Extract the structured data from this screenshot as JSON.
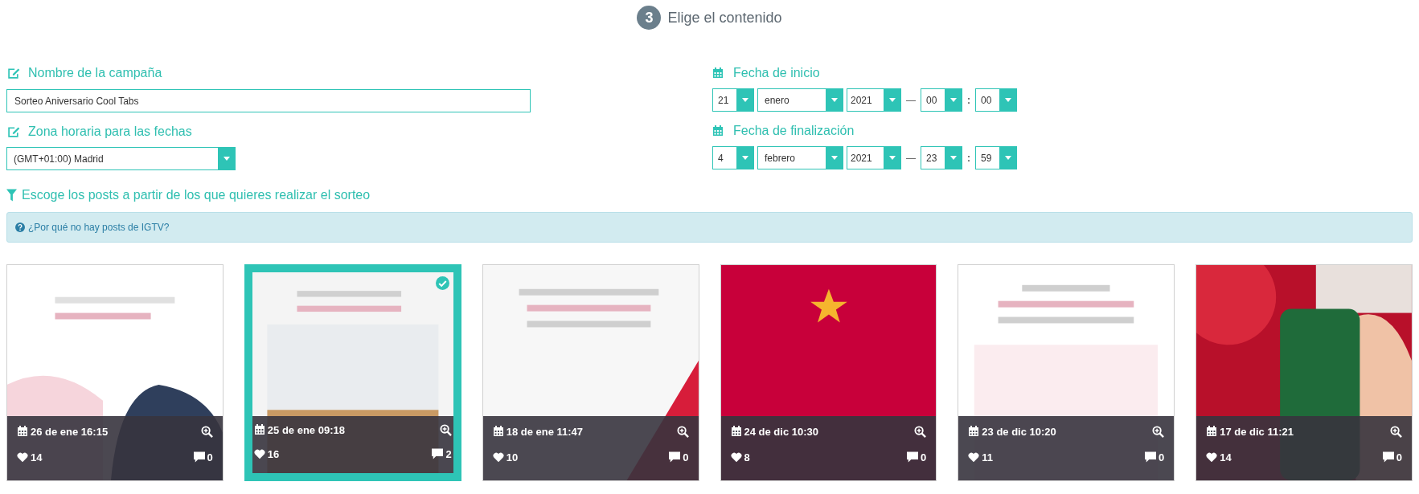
{
  "step": {
    "number": "3",
    "title": "Elige el contenido"
  },
  "campaign_name": {
    "label": "Nombre de la campaña",
    "value": "Sorteo Aniversario Cool Tabs"
  },
  "timezone": {
    "label": "Zona horaria para las fechas",
    "value": "(GMT+01:00) Madrid"
  },
  "start_date": {
    "label": "Fecha de inicio",
    "day": "21",
    "month": "enero",
    "year": "2021",
    "date_separator": "—",
    "hour": "00",
    "time_separator": ":",
    "minute": "00"
  },
  "end_date": {
    "label": "Fecha de finalización",
    "day": "4",
    "month": "febrero",
    "year": "2021",
    "date_separator": "—",
    "hour": "23",
    "time_separator": ":",
    "minute": "59"
  },
  "posts_filter": {
    "label": "Escoge los posts a partir de los que quieres realizar el sorteo"
  },
  "info": {
    "link": "¿Por qué no hay posts de IGTV?"
  },
  "posts": [
    {
      "kind": "picture",
      "date": "26 de ene 16:15",
      "likes": "14",
      "comments": "0",
      "selected": false
    },
    {
      "kind": "picture",
      "date": "25 de ene 09:18",
      "likes": "16",
      "comments": "2",
      "selected": true
    },
    {
      "kind": "picture",
      "date": "18 de ene 11:47",
      "likes": "10",
      "comments": "0",
      "selected": false
    },
    {
      "kind": "picture",
      "date": "24 de dic 10:30",
      "likes": "8",
      "comments": "0",
      "selected": false
    },
    {
      "kind": "picture",
      "date": "23 de dic 10:20",
      "likes": "11",
      "comments": "0",
      "selected": false
    },
    {
      "kind": "picture",
      "date": "17 de dic 11:21",
      "likes": "14",
      "comments": "0",
      "selected": false
    }
  ]
}
